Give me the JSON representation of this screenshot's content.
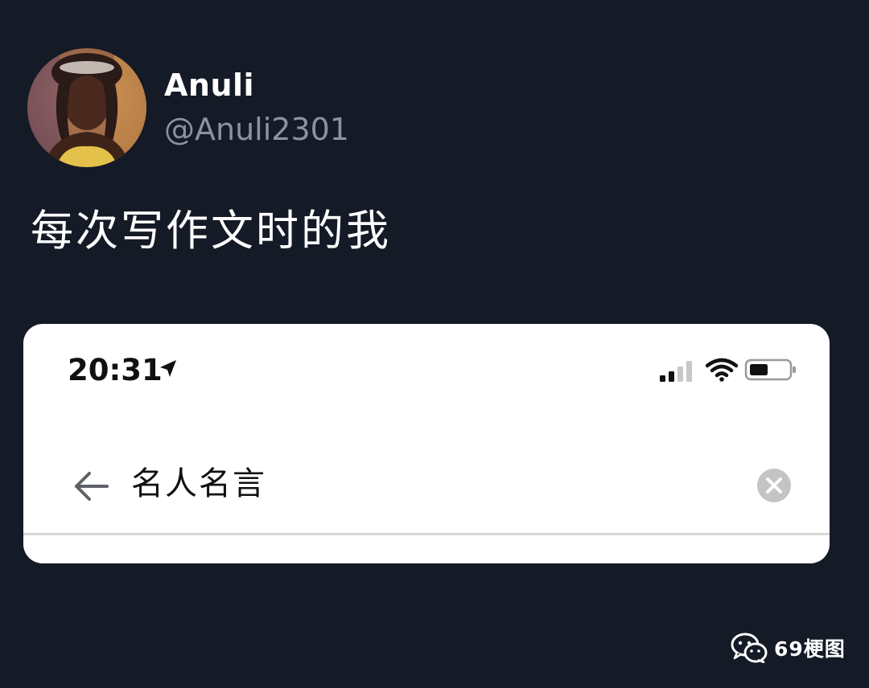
{
  "tweet": {
    "display_name": "Anuli",
    "handle": "@Anuli2301",
    "avatar": "profile-photo",
    "text": "每次写作文时的我"
  },
  "phone_screenshot": {
    "status_bar": {
      "time": "20:31",
      "icons": [
        "location-arrow-icon",
        "cellular-signal-icon",
        "wifi-icon",
        "battery-icon"
      ]
    },
    "search_bar": {
      "back_icon": "arrow-left-icon",
      "query": "名人名言",
      "clear_icon": "clear-circle-icon"
    }
  },
  "watermark": {
    "icon": "wechat-icon",
    "text": "69梗图"
  },
  "colors": {
    "background": "#141a26",
    "name": "#ffffff",
    "handle": "#8b93a0",
    "card": "#ffffff"
  }
}
